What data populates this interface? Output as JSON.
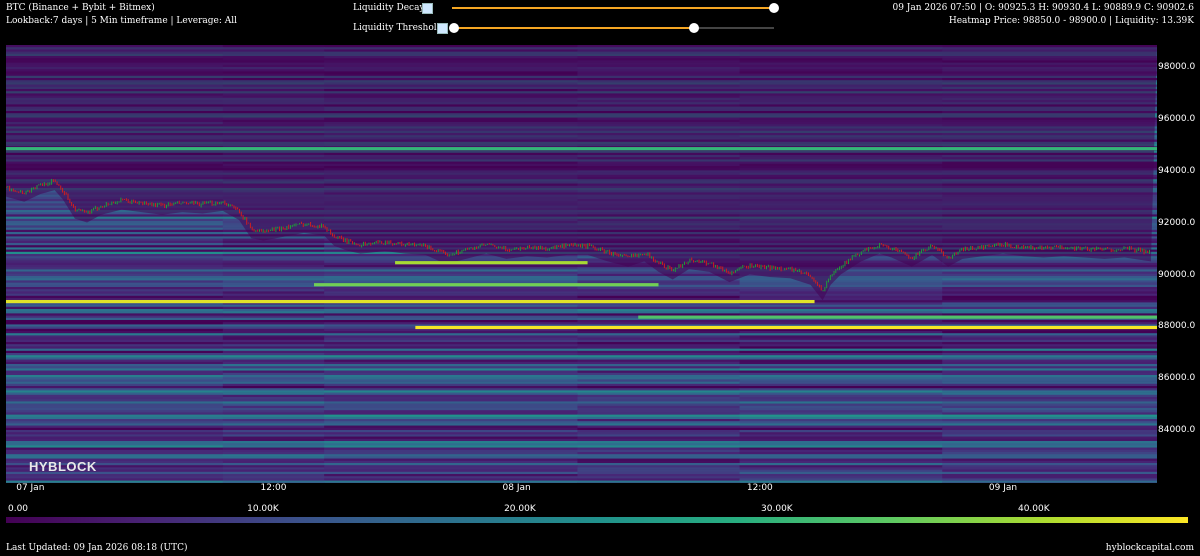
{
  "header": {
    "title": "BTC (Binance + Bybit + Bitmex)",
    "subtitle": "Lookback:7 days | 5 Min timeframe | Leverage: All",
    "ohlc": "09 Jan 2026 07:50 | O: 90925.3 H: 90930.4 L: 90889.9 C: 90902.6",
    "heatmap_info": "Heatmap Price: 98850.0 - 98900.0 | Liquidity: 13.39K"
  },
  "controls": {
    "decay_label": "Liquidity Decay",
    "threshold_label": "Liquidity Threshold",
    "decay_value": 1.0,
    "threshold_value": 0.75
  },
  "watermark": "HYBLOCK",
  "footer": {
    "last_updated": "Last Updated: 09 Jan 2026 08:18 (UTC)",
    "site": "hyblockcapital.com"
  },
  "colorbar": {
    "labels": [
      "0.00",
      "10.00K",
      "20.00K",
      "30.00K",
      "40.00K"
    ],
    "ticks": [
      0,
      10000,
      20000,
      30000,
      40000
    ],
    "max": 46000
  },
  "chart_data": {
    "type": "heatmap",
    "x_tick_labels": [
      "07 Jan",
      "12:00",
      "08 Jan",
      "12:00",
      "09 Jan"
    ],
    "x_ticks_hours": [
      0,
      12,
      24,
      36,
      48
    ],
    "x_range_hours": [
      -1.2,
      55.6
    ],
    "y_tick_labels": [
      "98000.0",
      "96000.0",
      "94000.0",
      "92000.0",
      "90000.0",
      "88000.0",
      "86000.0",
      "84000.0"
    ],
    "y_ticks": [
      98000,
      96000,
      94000,
      92000,
      90000,
      88000,
      86000,
      84000
    ],
    "ylim": [
      82000,
      98900
    ],
    "price_series": {
      "hours": [
        -1.2,
        -0.3,
        0.5,
        1.2,
        1.6,
        2.2,
        2.8,
        3.5,
        4.5,
        5.5,
        6.5,
        7.5,
        8.5,
        9.5,
        10.3,
        10.9,
        11.5,
        12.5,
        13.5,
        14.5,
        15.0,
        15.7,
        16.3,
        17.5,
        18.5,
        19.5,
        20.5,
        21.5,
        22.5,
        23.5,
        24.5,
        25.5,
        26.5,
        27.5,
        28.5,
        29.5,
        30.3,
        31.0,
        31.7,
        32.5,
        33.5,
        34.5,
        35.5,
        36.5,
        37.5,
        38.5,
        39.1,
        39.5,
        40.0,
        41.0,
        41.9,
        42.5,
        43.5,
        44.5,
        45.3,
        46.0,
        47.0,
        48.0,
        49.0,
        50.0,
        51.0,
        52.0,
        53.0,
        54.0,
        55.3
      ],
      "prices": [
        93400,
        93200,
        93500,
        93650,
        93300,
        92550,
        92400,
        92700,
        92900,
        92800,
        92700,
        92800,
        92750,
        92850,
        92500,
        91800,
        91700,
        91850,
        92000,
        91900,
        91500,
        91300,
        91200,
        91300,
        91200,
        91150,
        90800,
        91000,
        91200,
        91000,
        91100,
        91050,
        91150,
        91150,
        90900,
        90700,
        90900,
        90500,
        90200,
        90600,
        90500,
        90100,
        90400,
        90300,
        90250,
        90000,
        89400,
        90000,
        90400,
        90900,
        91200,
        91050,
        90700,
        91150,
        90700,
        91000,
        91100,
        91200,
        91100,
        91050,
        91100,
        91050,
        91000,
        91050,
        90900
      ]
    },
    "bands": [
      {
        "price": 89000,
        "value": 44000,
        "from_hours": -1.2,
        "to_hours": 38.7
      },
      {
        "price": 88000,
        "value": 45500,
        "from_hours": 19.0,
        "to_hours": 55.6
      },
      {
        "price": 89650,
        "value": 36000,
        "from_hours": 14.0,
        "to_hours": 31.0
      },
      {
        "price": 90500,
        "value": 40000,
        "from_hours": 18.0,
        "to_hours": 27.5
      },
      {
        "price": 88400,
        "value": 33000,
        "from_hours": 30.0,
        "to_hours": 55.6
      },
      {
        "price": 94900,
        "value": 30000,
        "from_hours": -1.2,
        "to_hours": 55.6
      }
    ]
  }
}
